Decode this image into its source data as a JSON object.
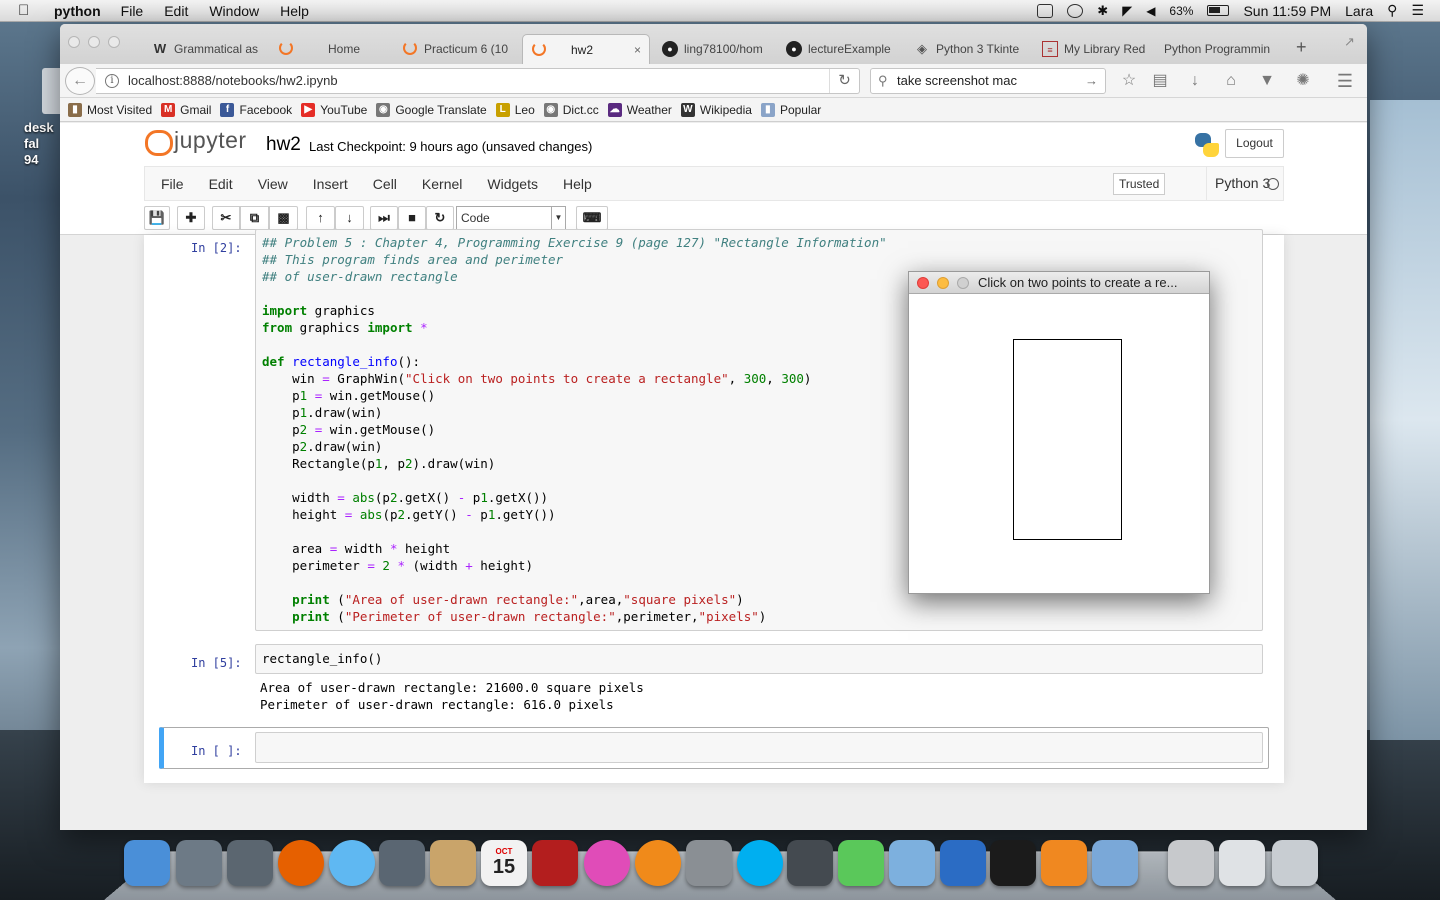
{
  "menubar": {
    "app_name": "python",
    "items": [
      "File",
      "Edit",
      "Window",
      "Help"
    ],
    "battery": "63%",
    "clock": "Sun 11:59 PM",
    "user": "Lara"
  },
  "desktop": {
    "icon_label": "desk\nfal\n94"
  },
  "browser": {
    "tabs": [
      {
        "label": "Grammatical as",
        "icon": "grammarly-icon"
      },
      {
        "label": "Home",
        "icon": "jupyter-icon"
      },
      {
        "label": "Practicum 6 (10",
        "icon": "jupyter-icon"
      },
      {
        "label": "hw2",
        "icon": "jupyter-icon",
        "active": true
      },
      {
        "label": "ling78100/hom",
        "icon": "github-icon"
      },
      {
        "label": "lectureExample",
        "icon": "github-icon"
      },
      {
        "label": "Python 3 Tkinte",
        "icon": "python-doc-icon"
      },
      {
        "label": "My Library Red",
        "icon": "document-icon"
      },
      {
        "label": "Python Programmin",
        "icon": "none"
      }
    ],
    "url": "localhost:8888/notebooks/hw2.ipynb",
    "search_value": "take screenshot mac",
    "bookmarks": [
      {
        "label": "Most Visited",
        "icon": "folder-icon",
        "color": "#8a6d4a"
      },
      {
        "label": "Gmail",
        "icon": "gmail-icon",
        "color": "#d93025"
      },
      {
        "label": "Facebook",
        "icon": "facebook-icon",
        "color": "#3b5998"
      },
      {
        "label": "YouTube",
        "icon": "youtube-icon",
        "color": "#e52d27"
      },
      {
        "label": "Google Translate",
        "icon": "globe-icon",
        "color": "#777777"
      },
      {
        "label": "Leo",
        "icon": "leo-icon",
        "color": "#c8a000"
      },
      {
        "label": "Dict.cc",
        "icon": "globe-icon",
        "color": "#777777"
      },
      {
        "label": "Weather",
        "icon": "weather-icon",
        "color": "#5a2a80"
      },
      {
        "label": "Wikipedia",
        "icon": "wikipedia-icon",
        "color": "#333333"
      },
      {
        "label": "Popular",
        "icon": "folder-icon",
        "color": "#8aa4c8"
      }
    ]
  },
  "jupyter": {
    "logo_text": "jupyter",
    "notebook_name": "hw2",
    "checkpoint": "Last Checkpoint: 9 hours ago (unsaved changes)",
    "logout": "Logout",
    "menu": [
      "File",
      "Edit",
      "View",
      "Insert",
      "Cell",
      "Kernel",
      "Widgets",
      "Help"
    ],
    "trusted": "Trusted",
    "kernel": "Python 3",
    "cell_type": "Code",
    "accent_color": "#f37626"
  },
  "cells": [
    {
      "prompt": "In [2]:",
      "source": [
        "## Problem 5 : Chapter 4, Programming Exercise 9 (page 127) \"Rectangle Information\"",
        "## This program finds area and perimeter",
        "## of user-drawn rectangle",
        "",
        "import graphics",
        "from graphics import *",
        "",
        "def rectangle_info():",
        "    win = GraphWin(\"Click on two points to create a rectangle\", 300, 300)",
        "    p1 = win.getMouse()",
        "    p1.draw(win)",
        "    p2 = win.getMouse()",
        "    p2.draw(win)",
        "    Rectangle(p1, p2).draw(win)",
        "",
        "    width = abs(p2.getX() - p1.getX())",
        "    height = abs(p2.getY() - p1.getY())",
        "",
        "    area = width * height",
        "    perimeter = 2 * (width + height)",
        "",
        "    print (\"Area of user-drawn rectangle:\",area,\"square pixels\")",
        "    print (\"Perimeter of user-drawn rectangle:\",perimeter,\"pixels\")"
      ]
    },
    {
      "prompt": "In [5]:",
      "source": [
        "rectangle_info()"
      ],
      "output": [
        "Area of user-drawn rectangle: 21600.0 square pixels",
        "Perimeter of user-drawn rectangle: 616.0 pixels"
      ]
    },
    {
      "prompt": "In [ ]:",
      "source": [
        ""
      ]
    }
  ],
  "graphwin": {
    "title": "Click on two points to create a re..."
  },
  "dock": [
    {
      "name": "finder-icon",
      "color": "#4a8fd8"
    },
    {
      "name": "launchpad-icon",
      "color": "#6d7a86"
    },
    {
      "name": "image-capture-icon",
      "color": "#5b6670"
    },
    {
      "name": "firefox-icon",
      "color": "#e66000"
    },
    {
      "name": "messages-icon",
      "color": "#5fb8f2"
    },
    {
      "name": "facetime-icon",
      "color": "#5a6672"
    },
    {
      "name": "contacts-icon",
      "color": "#c9a46a"
    },
    {
      "name": "calendar-icon",
      "color": "#f2f2f2"
    },
    {
      "name": "photo-booth-icon",
      "color": "#b31e1e"
    },
    {
      "name": "itunes-icon",
      "color": "#e04cb8"
    },
    {
      "name": "ibooks-icon",
      "color": "#f08a1a"
    },
    {
      "name": "system-preferences-icon",
      "color": "#8a8f94"
    },
    {
      "name": "skype-icon",
      "color": "#00aff0"
    },
    {
      "name": "disk-utility-icon",
      "color": "#444a50"
    },
    {
      "name": "photos-icon",
      "color": "#5ac85a"
    },
    {
      "name": "preview-icon",
      "color": "#7db0de"
    },
    {
      "name": "word-icon",
      "color": "#2b6cc4"
    },
    {
      "name": "terminal-icon",
      "color": "#1b1b1b"
    },
    {
      "name": "sublime-text-icon",
      "color": "#f08820"
    },
    {
      "name": "feather-icon",
      "color": "#7aa8d8"
    },
    {
      "name": "documents-folder-icon",
      "color": "#c7c9cc"
    },
    {
      "name": "downloads-stack-icon",
      "color": "#dfe2e5"
    },
    {
      "name": "trash-icon",
      "color": "#c8cdd2"
    }
  ],
  "calendar_day": "15",
  "calendar_month": "OCT"
}
